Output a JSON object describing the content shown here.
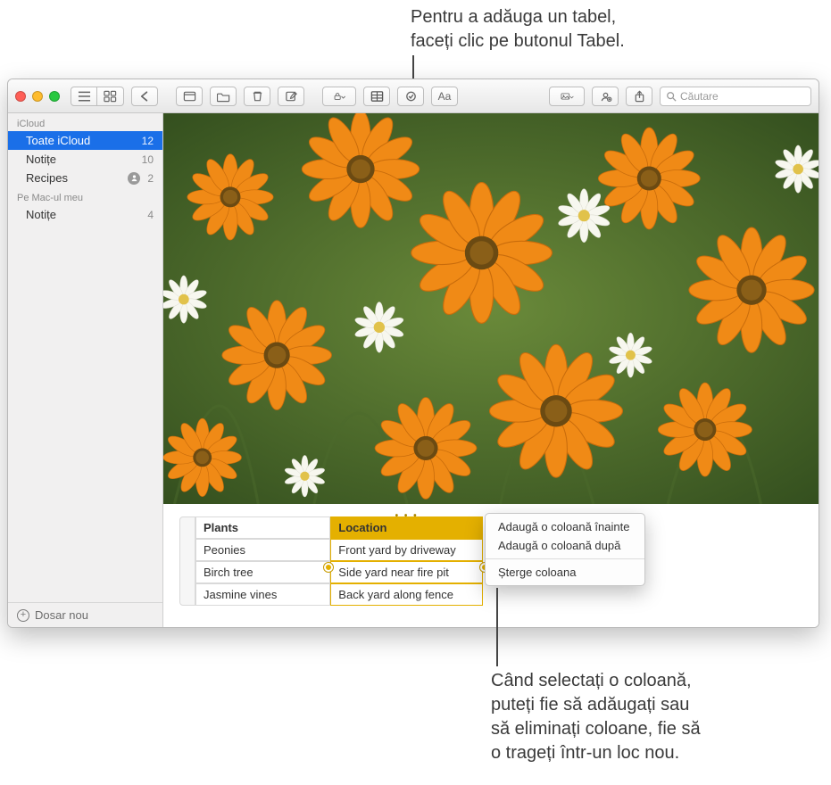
{
  "callouts": {
    "top": "Pentru a adăuga un tabel,\nfaceți clic pe butonul Tabel.",
    "bottom": "Când selectați o coloană,\nputeți fie să adăugați sau\nsă eliminați coloane, fie să\no trageți într-un loc nou."
  },
  "search": {
    "placeholder": "Căutare"
  },
  "sidebar": {
    "sections": [
      {
        "label": "iCloud",
        "items": [
          {
            "name": "Toate iCloud",
            "count": "12",
            "selected": true,
            "shared": false
          },
          {
            "name": "Notițe",
            "count": "10",
            "selected": false,
            "shared": false
          },
          {
            "name": "Recipes",
            "count": "2",
            "selected": false,
            "shared": true
          }
        ]
      },
      {
        "label": "Pe Mac-ul meu",
        "items": [
          {
            "name": "Notițe",
            "count": "4",
            "selected": false,
            "shared": false
          }
        ]
      }
    ],
    "new_folder_label": "Dosar nou"
  },
  "table": {
    "headers": [
      "Plants",
      "Location"
    ],
    "rows": [
      [
        "Peonies",
        "Front yard by driveway"
      ],
      [
        "Birch tree",
        "Side yard near fire pit"
      ],
      [
        "Jasmine vines",
        "Back yard along fence"
      ]
    ]
  },
  "context_menu": {
    "items": [
      "Adaugă o coloană înainte",
      "Adaugă o coloană după"
    ],
    "delete": "Șterge coloana"
  }
}
